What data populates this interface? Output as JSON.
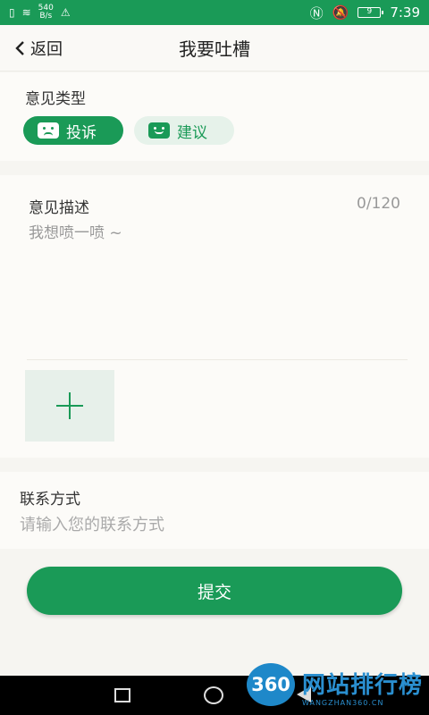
{
  "status_bar": {
    "speed_value": "540",
    "speed_unit": "B/s",
    "battery": "9",
    "time": "7:39"
  },
  "nav": {
    "back_label": "返回",
    "title": "我要吐槽"
  },
  "feedback_type": {
    "label": "意见类型",
    "options": [
      {
        "label": "投诉",
        "icon": "sad-face-icon",
        "selected": true
      },
      {
        "label": "建议",
        "icon": "smile-face-icon",
        "selected": false
      }
    ]
  },
  "description": {
    "label": "意见描述",
    "counter": "0/120",
    "placeholder": "我想喷一喷 ~"
  },
  "contact": {
    "label": "联系方式",
    "placeholder": "请输入您的联系方式"
  },
  "submit_label": "提交",
  "watermark": {
    "badge": "360",
    "text": "网站排行榜",
    "url": "WANGZHAN360.CN"
  },
  "colors": {
    "accent": "#1a9a57",
    "accent_light": "#e6f2ea",
    "background": "#f6f5f1"
  }
}
